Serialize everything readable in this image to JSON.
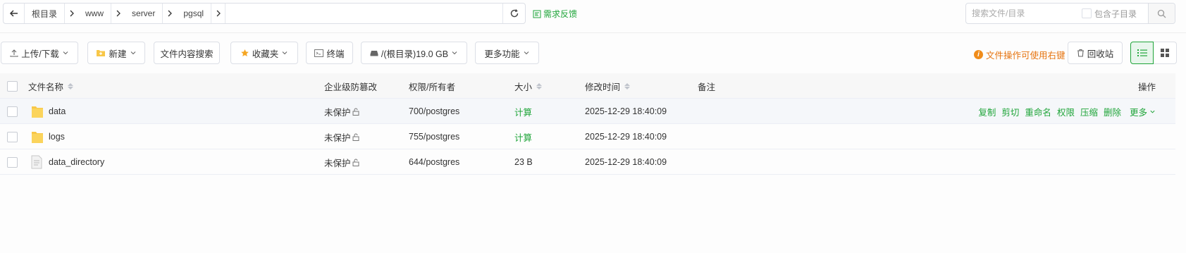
{
  "breadcrumb": {
    "items": [
      "根目录",
      "www",
      "server",
      "pgsql"
    ]
  },
  "feedback_label": "需求反馈",
  "search": {
    "placeholder": "搜索文件/目录",
    "include_sub_label": "包含子目录"
  },
  "toolbar": {
    "upload_label": "上传/下载",
    "new_label": "新建",
    "content_search_label": "文件内容搜索",
    "favorites_label": "收藏夹",
    "terminal_label": "终端",
    "disk_label": "/(根目录)19.0 GB",
    "more_label": "更多功能",
    "tip_label": "文件操作可使用右键",
    "recycle_label": "回收站"
  },
  "table": {
    "headers": {
      "name": "文件名称",
      "protect": "企业级防篡改",
      "perm": "权限/所有者",
      "size": "大小",
      "mtime": "修改时间",
      "note": "备注",
      "ops": "操作"
    },
    "rows": [
      {
        "name": "data",
        "type": "folder",
        "protect": "未保护",
        "perm": "700/postgres",
        "size": "计算",
        "mtime": "2025-12-29 18:40:09"
      },
      {
        "name": "logs",
        "type": "folder",
        "protect": "未保护",
        "perm": "755/postgres",
        "size": "计算",
        "mtime": "2025-12-29 18:40:09"
      },
      {
        "name": "data_directory",
        "type": "file",
        "protect": "未保护",
        "perm": "644/postgres",
        "size": "23 B",
        "mtime": "2025-12-29 18:40:09"
      }
    ],
    "row_ops": [
      "复制",
      "剪切",
      "重命名",
      "权限",
      "压缩",
      "删除"
    ],
    "row_ops_more": "更多"
  },
  "colors": {
    "accent": "#20a53a",
    "warning": "#e6740f",
    "folder": "#f8c748"
  },
  "icons": {
    "back": "arrow-left-icon",
    "refresh": "refresh-icon",
    "search": "search-icon",
    "folder": "folder-icon",
    "file": "file-icon",
    "lock": "unlock-icon",
    "list_view": "list-view-icon",
    "grid_view": "grid-view-icon"
  }
}
